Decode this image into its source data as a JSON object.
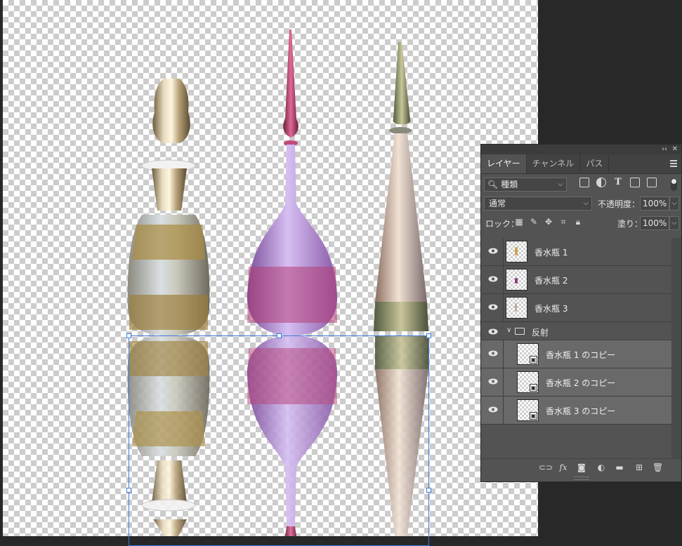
{
  "panel": {
    "tabs": [
      "レイヤー",
      "チャンネル",
      "パス"
    ],
    "filter": {
      "kind_label": "種類"
    },
    "blend_mode": "通常",
    "opacity_label": "不透明度：",
    "opacity_value": "100%",
    "lock_label": "ロック：",
    "fill_label": "塗り：",
    "fill_value": "100%"
  },
  "layers": [
    {
      "name": "香水瓶 1",
      "color": "#c9a458"
    },
    {
      "name": "香水瓶 2",
      "color": "#8a3a7a"
    },
    {
      "name": "香水瓶 3",
      "color": "#b8aaa0"
    },
    {
      "group": true,
      "name": "反射"
    },
    {
      "name": "香水瓶 1 のコピー",
      "selected": true
    },
    {
      "name": "香水瓶 2 のコピー",
      "selected": true
    },
    {
      "name": "香水瓶 3 のコピー",
      "selected": true
    }
  ],
  "icons": {
    "filter": [
      "image-filter-icon",
      "adjustment-filter-icon",
      "type-filter-icon",
      "shape-filter-icon",
      "smart-object-filter-icon"
    ],
    "lock": [
      "lock-transparent-icon",
      "lock-image-icon",
      "lock-position-icon",
      "lock-artboard-icon",
      "lock-all-icon"
    ],
    "footer": [
      "link-icon",
      "fx-icon",
      "mask-icon",
      "adjustment-layer-icon",
      "new-group-icon",
      "new-layer-icon",
      "trash-icon"
    ]
  }
}
